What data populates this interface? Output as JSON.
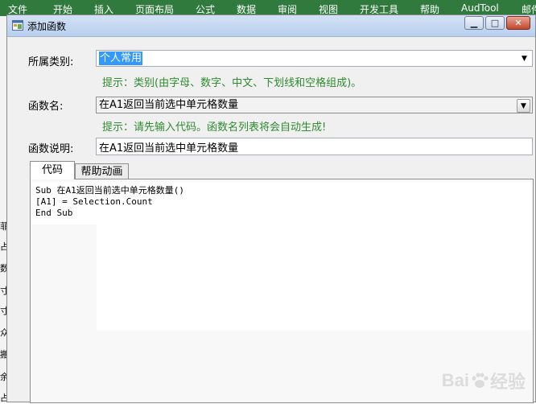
{
  "excel": {
    "menu": [
      "文件",
      "开始",
      "插入",
      "页面布局",
      "公式",
      "数据",
      "审阅",
      "视图",
      "开发工具",
      "帮助",
      "AudTool",
      "邮件"
    ],
    "left_chars": [
      "菲",
      "占",
      "数",
      "寸",
      "寸",
      "众",
      "搬",
      "余",
      "占"
    ]
  },
  "dialog": {
    "title": "添加函数",
    "window_buttons": {
      "minimize": "▁",
      "restore": "□",
      "close": "✕"
    },
    "category": {
      "label": "所属类别:",
      "value": "个人常用",
      "hint": "提示：类别(由字母、数字、中文、下划线和空格组成)。"
    },
    "function_name": {
      "label": "函数名:",
      "value": "在A1返回当前选中单元格数量",
      "hint": "提示：请先输入代码。函数名列表将会自动生成!"
    },
    "description": {
      "label": "函数说明:",
      "value": "在A1返回当前选中单元格数量"
    },
    "tabs": [
      {
        "label": "代码"
      },
      {
        "label": "帮助动画"
      }
    ],
    "code_lines": [
      "Sub 在A1返回当前选中单元格数量()",
      "[A1] = Selection.Count",
      "End Sub"
    ]
  },
  "watermark": {
    "text": "Bai",
    "suffix": "经验"
  }
}
